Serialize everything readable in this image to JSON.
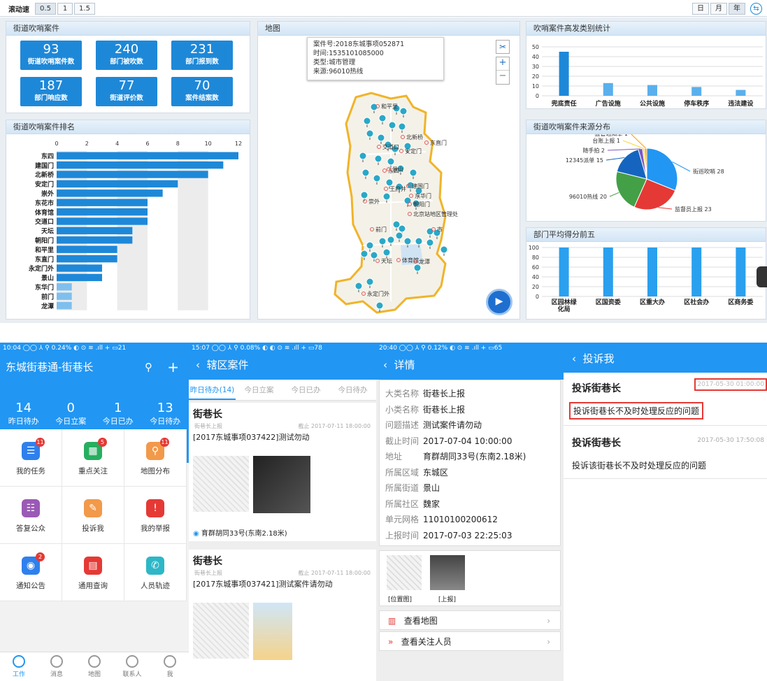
{
  "toolbar": {
    "speed_label": "滚动速",
    "speeds": [
      "0.5",
      "1",
      "1.5"
    ],
    "periods": [
      "日",
      "月",
      "年"
    ]
  },
  "stats": {
    "title": "街道吹哨案件",
    "tiles": [
      {
        "value": "93",
        "label": "街道吹哨案件数"
      },
      {
        "value": "240",
        "label": "部门被吹数"
      },
      {
        "value": "231",
        "label": "部门报到数"
      },
      {
        "value": "187",
        "label": "部门响应数"
      },
      {
        "value": "77",
        "label": "街道评价数"
      },
      {
        "value": "70",
        "label": "案件结案数"
      }
    ]
  },
  "map": {
    "title": "地图",
    "popup": [
      "案件号:2018东城事项052871",
      "时间:1535101085000",
      "类型:城市管理",
      "来源:96010热线"
    ],
    "labels": [
      "和平里",
      "北新桥",
      "东直门",
      "安定门",
      "交道口",
      "东四",
      "建国门",
      "王府井",
      "朝阳门",
      "东华门",
      "北京站地区管理处",
      "前门",
      "天坛",
      "体育馆",
      "龙潭",
      "永定门外",
      "景山",
      "崇外",
      "市"
    ],
    "zoom_in": "+",
    "zoom_out": "−"
  },
  "chart_data": [
    {
      "type": "bar",
      "title": "街道吹哨案件排名",
      "orientation": "horizontal",
      "categories": [
        "东四",
        "建国门",
        "北新桥",
        "安定门",
        "崇外",
        "东花市",
        "体育馆",
        "交道口",
        "天坛",
        "朝阳门",
        "和平里",
        "东直门",
        "永定门外",
        "景山",
        "东华门",
        "前门",
        "龙潭"
      ],
      "values": [
        12,
        11,
        10,
        8,
        7,
        6,
        6,
        6,
        5,
        5,
        4,
        4,
        3,
        3,
        1,
        1,
        1
      ],
      "xticks": [
        0,
        2,
        4,
        6,
        8,
        10,
        12
      ],
      "xlim": [
        0,
        12
      ]
    },
    {
      "type": "bar",
      "title": "吹哨案件高发类别统计",
      "categories": [
        "兜底责任",
        "广告设施",
        "公共设施",
        "停车秩序",
        "违法建设"
      ],
      "values": [
        45,
        13,
        11,
        9,
        6
      ],
      "yticks": [
        0,
        10,
        20,
        30,
        40,
        50
      ],
      "ylim": [
        0,
        50
      ]
    },
    {
      "type": "pie",
      "title": "街道吹哨案件来源分布",
      "labels": [
        "街巡吹哨",
        "监督员上报",
        "96010热线",
        "12345派单",
        "随手拍",
        "台账上报",
        "监管通知单"
      ],
      "values": [
        28,
        23,
        20,
        15,
        2,
        1,
        1
      ],
      "colors": [
        "#2196f3",
        "#e53935",
        "#43a047",
        "#1565c0",
        "#7e57c2",
        "#fdd835",
        "#ff9800"
      ]
    },
    {
      "type": "bar",
      "title": "部门平均得分前五",
      "categories": [
        "区园林绿化局",
        "区国资委",
        "区重大办",
        "区社会办",
        "区商务委"
      ],
      "values": [
        100,
        100,
        100,
        100,
        100
      ],
      "yticks": [
        0,
        20,
        40,
        60,
        80,
        100
      ],
      "ylim": [
        0,
        100
      ]
    }
  ],
  "phone1": {
    "status": "10:04 ◯◯ ⅄ ⚲                          0.24% ◐ ⊙ ≋ .ıll + ▭21",
    "title": "东城街巷通-街巷长",
    "stats": [
      {
        "v": "14",
        "l": "昨日待办"
      },
      {
        "v": "0",
        "l": "今日立案"
      },
      {
        "v": "1",
        "l": "今日已办"
      },
      {
        "v": "13",
        "l": "今日待办"
      }
    ],
    "grid": [
      {
        "label": "我的任务",
        "color": "#2f80ed",
        "badge": "11"
      },
      {
        "label": "重点关注",
        "color": "#27ae60",
        "badge": "5"
      },
      {
        "label": "地图分布",
        "color": "#f2994a",
        "badge": "11"
      },
      {
        "label": "答复公众",
        "color": "#9b59b6",
        "badge": ""
      },
      {
        "label": "投诉我",
        "color": "#f2994a",
        "badge": ""
      },
      {
        "label": "我的举报",
        "color": "#e53935",
        "badge": ""
      },
      {
        "label": "通知公告",
        "color": "#2f80ed",
        "badge": "2"
      },
      {
        "label": "通用查询",
        "color": "#e53935",
        "badge": ""
      },
      {
        "label": "人员轨迹",
        "color": "#2db7c7",
        "badge": ""
      }
    ],
    "tabs": [
      "工作",
      "消息",
      "地图",
      "联系人",
      "我"
    ]
  },
  "phone2": {
    "status": "15:07 ◯◯ ⅄ ⚲                0.08% ◐ ◐ ⊙ ≋ .ıll + ▭78",
    "title": "辖区案件",
    "tabs": [
      "昨日待办(14)",
      "今日立案",
      "今日已办",
      "今日待办"
    ],
    "cases": [
      {
        "title": "街巷长",
        "sub": "街巷长上报",
        "due": "截止 2017-07-11 18:00:00",
        "desc": "[2017东城事项037422]测试勿动",
        "addr": "育群胡同33号(东南2.18米)"
      },
      {
        "title": "街巷长",
        "sub": "街巷长上报",
        "due": "截止 2017-07-11 18:00:00",
        "desc": "[2017东城事项037421]测试案件请勿动",
        "addr": ""
      }
    ]
  },
  "phone3": {
    "status": "20:40 ◯◯ ⅄ ⚲                       0.12% ◐ ⊙ ≋ .ıll + ▭65",
    "title": "详情",
    "rows": [
      {
        "k": "大类名称",
        "v": "街巷长上报"
      },
      {
        "k": "小类名称",
        "v": "街巷长上报"
      },
      {
        "k": "问题描述",
        "v": "测试案件请勿动"
      },
      {
        "k": "截止时间",
        "v": "2017-07-04 10:00:00"
      },
      {
        "k": "地址",
        "v": "育群胡同33号(东南2.18米)"
      },
      {
        "k": "所属区域",
        "v": "东城区"
      },
      {
        "k": "所属街道",
        "v": "景山"
      },
      {
        "k": "所属社区",
        "v": "魏家"
      },
      {
        "k": "单元网格",
        "v": "11010100200612"
      },
      {
        "k": "上报时间",
        "v": "2017-07-03 22:25:03"
      }
    ],
    "photos": [
      "[位置图]",
      "[上报]"
    ],
    "links": [
      "查看地图",
      "查看关注人员"
    ]
  },
  "phone4": {
    "title": "投诉我",
    "items": [
      {
        "title": "投诉街巷长",
        "time": "2017-05-30 01:00:00",
        "desc": "投诉街巷长不及时处理反应的问题"
      },
      {
        "title": "投诉街巷长",
        "time": "2017-05-30 17:50:08",
        "desc": "投诉该街巷长不及时处理反应的问题"
      }
    ]
  }
}
